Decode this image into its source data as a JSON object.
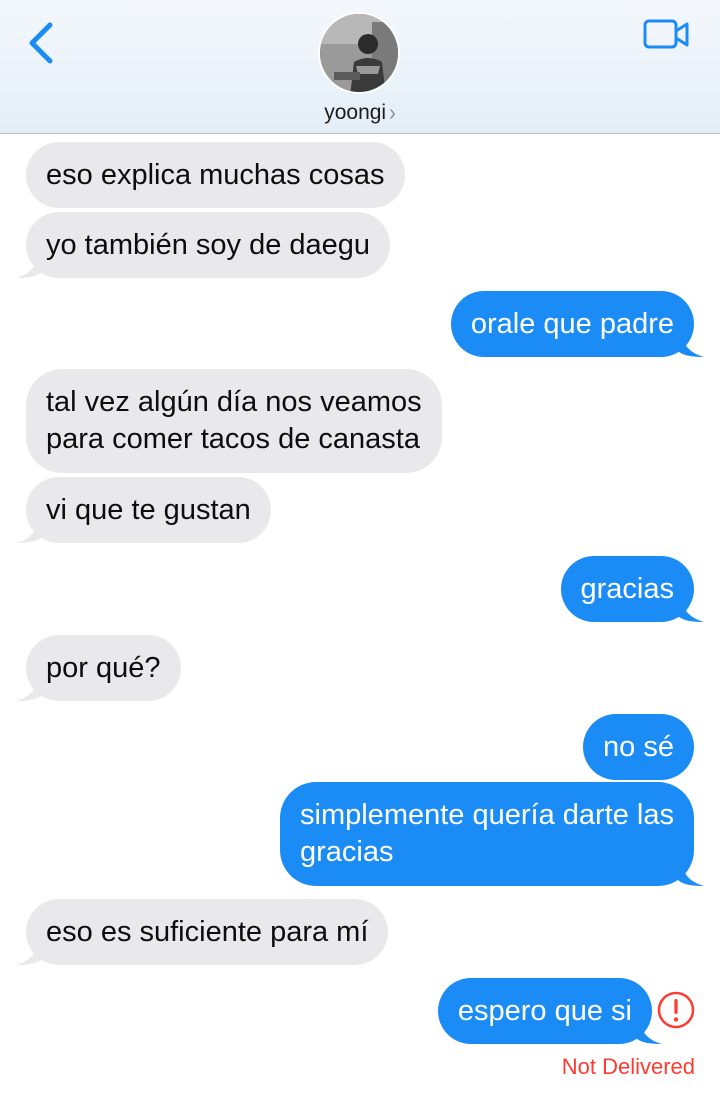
{
  "header": {
    "contact_name": "yoongi",
    "back_icon": "chevron-left-icon",
    "video_icon": "video-camera-icon",
    "accent_color": "#1b8cf5"
  },
  "messages": [
    {
      "direction": "in",
      "text": "eso explica muchas cosas"
    },
    {
      "direction": "in",
      "text": "yo también soy de daegu"
    },
    {
      "direction": "out",
      "text": "orale que padre"
    },
    {
      "direction": "in",
      "text": [
        "tal vez algún día nos veamos",
        "para comer tacos de canasta"
      ]
    },
    {
      "direction": "in",
      "text": "vi que te gustan"
    },
    {
      "direction": "out",
      "text": "gracias"
    },
    {
      "direction": "in",
      "text": "por qué?"
    },
    {
      "direction": "out",
      "text": "no sé"
    },
    {
      "direction": "out",
      "text": [
        "simplemente quería darte las",
        "gracias"
      ]
    },
    {
      "direction": "in",
      "text": "eso es suficiente para mí"
    },
    {
      "direction": "out",
      "text": "espero que si"
    }
  ],
  "status": {
    "not_delivered": "Not Delivered",
    "error_icon": "exclamation-circle-icon",
    "error_color": "#fe3b30"
  }
}
